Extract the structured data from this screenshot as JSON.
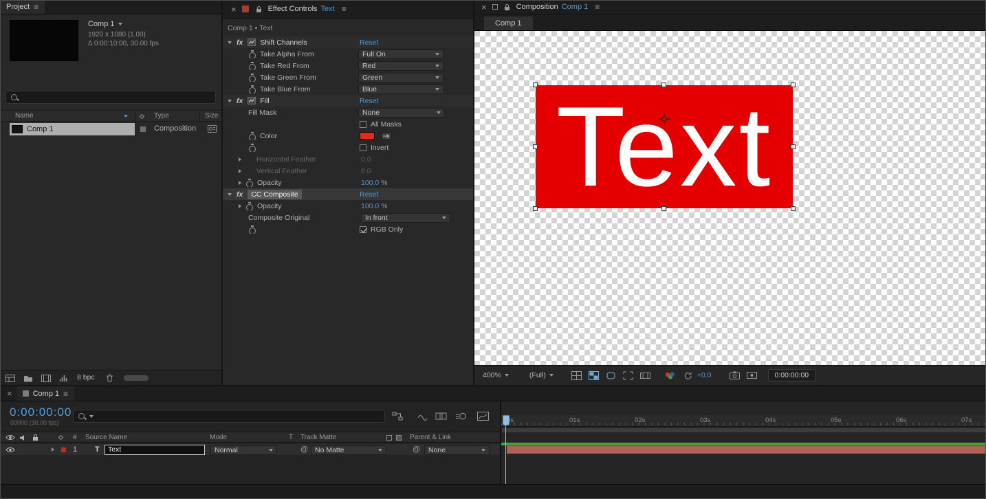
{
  "glyphs": {
    "close": "×",
    "menu": "≡",
    "fx": "fx",
    "pickwhip": "@",
    "hash": "#"
  },
  "colors": {
    "accent_blue": "#4e97d3",
    "timecode_blue": "#4ea0dc",
    "fill_red": "#e12b1e",
    "canvas_fill_red": "#e40000",
    "render_bar_green": "#4aa233",
    "layer_bar_red": "#ad6157"
  },
  "project_panel": {
    "tab": "Project",
    "preview": {
      "title": "Comp 1",
      "resolution": "1920 x 1080 (1.00)",
      "duration": "Δ 0:00:10:00, 30.00 fps"
    },
    "columns": {
      "name": "Name",
      "type": "Type",
      "size": "Size"
    },
    "item": {
      "name": "Comp 1",
      "type": "Composition"
    },
    "footer": {
      "depth": "8 bpc"
    }
  },
  "effects_panel": {
    "tab_title": "Effect Controls",
    "tab_layer": "Text",
    "breadcrumb": "Comp 1 • Text",
    "reset": "Reset",
    "shift_channels": {
      "name": "Shift Channels",
      "rows": [
        {
          "label": "Take Alpha From",
          "value": "Full On"
        },
        {
          "label": "Take Red From",
          "value": "Red"
        },
        {
          "label": "Take Green From",
          "value": "Green"
        },
        {
          "label": "Take Blue From",
          "value": "Blue"
        }
      ]
    },
    "fill": {
      "name": "Fill",
      "mask_label": "Fill Mask",
      "mask_value": "None",
      "all_masks": "All Masks",
      "color_label": "Color",
      "invert": "Invert",
      "h_feather": "Horizontal Feather",
      "h_feather_value": "0.0",
      "v_feather": "Vertical Feather",
      "v_feather_value": "0.0",
      "opacity": "Opacity",
      "opacity_value": "100.0",
      "opacity_unit": "%"
    },
    "cc_composite": {
      "name": "CC Composite",
      "opacity": "Opacity",
      "opacity_value": "100.0",
      "opacity_unit": "%",
      "composite_original": "Composite Original",
      "composite_value": "In front",
      "rgb_only": "RGB Only"
    }
  },
  "comp_panel": {
    "tab_title": "Composition",
    "tab_comp": "Comp 1",
    "viewer_tab": "Comp 1",
    "canvas": {
      "text": "Text"
    },
    "toolbar": {
      "zoom": "400%",
      "resolution": "(Full)",
      "exposure": "+0.0",
      "timecode": "0:00:00:00"
    }
  },
  "timeline_panel": {
    "tab": "Comp 1",
    "timecode": "0:00:00:00",
    "frames": "00000 (30.00 fps)",
    "columns": {
      "index": "#",
      "source_name": "Source Name",
      "mode": "Mode",
      "switches": "T",
      "track_matte": "Track Matte",
      "parent": "Parent & Link"
    },
    "layer": {
      "index": "1",
      "icon": "T",
      "name": "Text",
      "mode": "Normal",
      "track_matte": "No Matte",
      "parent": "None"
    },
    "ruler": [
      "0s",
      "01s",
      "02s",
      "03s",
      "04s",
      "05s",
      "06s",
      "07s"
    ]
  }
}
